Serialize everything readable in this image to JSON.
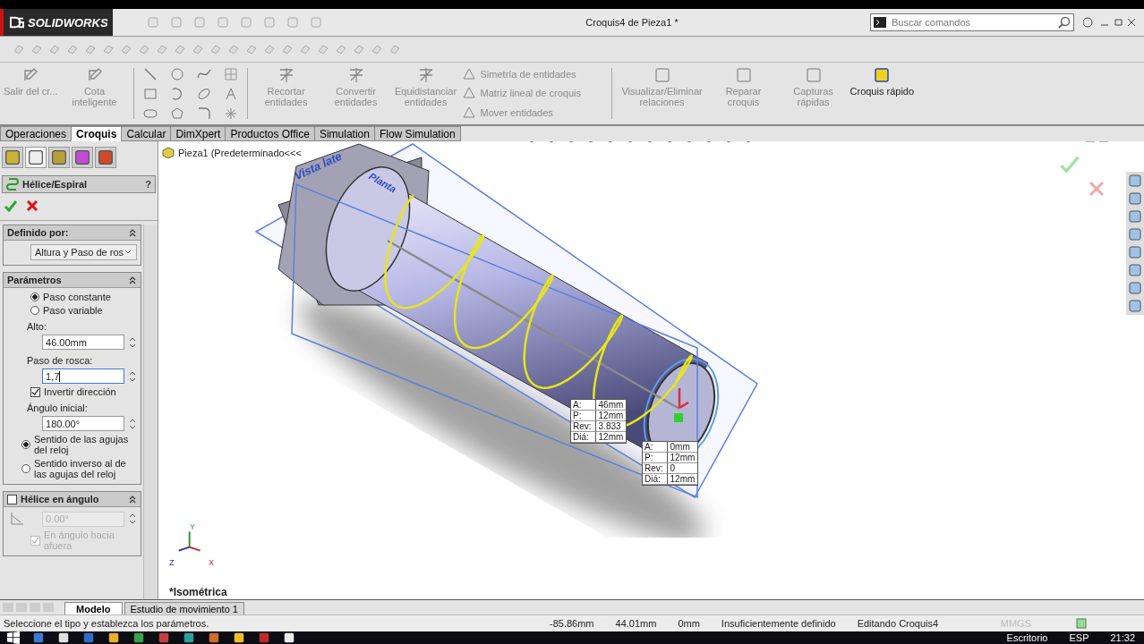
{
  "title_bar": {
    "logo": "SOLIDWORKS",
    "document": "Croquis4 de Pieza1 *",
    "search": {
      "placeholder": "Buscar comandos"
    }
  },
  "ribbon": {
    "large": [
      {
        "label": "Salir del cr...",
        "disabled": true
      },
      {
        "label": "Cota inteligente",
        "disabled": true
      }
    ],
    "mid": [
      {
        "label": "Recortar entidades",
        "disabled": true
      },
      {
        "label": "Convertir entidades",
        "disabled": true
      },
      {
        "label": "Equidistanciar entidades",
        "disabled": true
      }
    ],
    "list": [
      {
        "label": "Simetría de entidades",
        "disabled": true
      },
      {
        "label": "Matriz lineal de croquis",
        "disabled": true
      },
      {
        "label": "Mover entidades",
        "disabled": true
      }
    ],
    "right": [
      {
        "label": "Visualizar/Eliminar relaciones",
        "disabled": true
      },
      {
        "label": "Reparar croquis",
        "disabled": true
      },
      {
        "label": "Capturas rápidas",
        "disabled": true
      },
      {
        "label": "Croquis rápido",
        "disabled": false
      }
    ]
  },
  "tabs": [
    {
      "label": "Operaciones",
      "selected": false
    },
    {
      "label": "Croquis",
      "selected": true
    },
    {
      "label": "Calcular",
      "selected": false
    },
    {
      "label": "DimXpert",
      "selected": false
    },
    {
      "label": "Productos Office",
      "selected": false
    },
    {
      "label": "Simulation",
      "selected": false
    },
    {
      "label": "Flow Simulation",
      "selected": false
    }
  ],
  "panel": {
    "title": "Hélice/Espiral",
    "help": "?",
    "sections": [
      {
        "title": "Definido por:",
        "items": [
          {
            "kind": "select",
            "value": "Altura y Paso de ros"
          }
        ]
      },
      {
        "title": "Parámetros",
        "items": [
          {
            "kind": "radio",
            "label": "Paso constante",
            "selected": true
          },
          {
            "kind": "radio",
            "label": "Paso variable",
            "selected": false
          },
          {
            "kind": "label",
            "label": "Alto:"
          },
          {
            "kind": "field",
            "value": "46.00mm",
            "focused": false,
            "disabled": false
          },
          {
            "kind": "label",
            "label": "Paso de rosca:"
          },
          {
            "kind": "field",
            "value": "1,7",
            "focused": true,
            "disabled": false
          },
          {
            "kind": "checkbox",
            "label": "Invertir dirección",
            "checked": true,
            "disabled": false
          },
          {
            "kind": "label",
            "label": "Ángulo inicial:"
          },
          {
            "kind": "field",
            "value": "180.00°",
            "focused": false,
            "disabled": false
          },
          {
            "kind": "radio",
            "label": "Sentido de las agujas del reloj",
            "selected": true
          },
          {
            "kind": "radio",
            "label": "Sentido inverso al de las agujas del reloj",
            "selected": false
          }
        ]
      },
      {
        "title": "Hélice en ángulo",
        "checked": false,
        "items": [
          {
            "kind": "field",
            "value": "0.00°",
            "focused": false,
            "disabled": true
          },
          {
            "kind": "checkbox",
            "label": "En ángulo hacia afuera",
            "checked": true,
            "disabled": true
          }
        ]
      }
    ]
  },
  "viewport": {
    "tree_root": "Pieza1  (Predeterminado<<<",
    "plane_labels": [
      "Vista late",
      "Planta"
    ],
    "callouts": [
      {
        "rows": [
          {
            "key": "A:",
            "value": "46mm"
          },
          {
            "key": "P:",
            "value": "12mm"
          },
          {
            "key": "Rev:",
            "value": "3.833"
          },
          {
            "key": "Diá:",
            "value": "12mm"
          }
        ]
      },
      {
        "rows": [
          {
            "key": "A:",
            "value": "0mm"
          },
          {
            "key": "P:",
            "value": "12mm"
          },
          {
            "key": "Rev:",
            "value": "0"
          },
          {
            "key": "Diá:",
            "value": "12mm"
          }
        ]
      }
    ],
    "view_name": "*Isométrica",
    "axes": [
      "Y",
      "Z",
      "X"
    ]
  },
  "bottom_tabs": [
    {
      "label": "Modelo",
      "selected": true
    },
    {
      "label": "Estudio de movimiento 1",
      "selected": false
    }
  ],
  "status_bar": {
    "message": "Seleccione el tipo y establezca los parámetros.",
    "fields": [
      "-85.86mm",
      "44.01mm",
      "0mm",
      "Insuficientemente definido",
      "Editando Croquis4"
    ],
    "units": "MMGS"
  },
  "taskbar": {
    "items": [
      "Escritorio",
      "ESP",
      "21:32"
    ]
  }
}
